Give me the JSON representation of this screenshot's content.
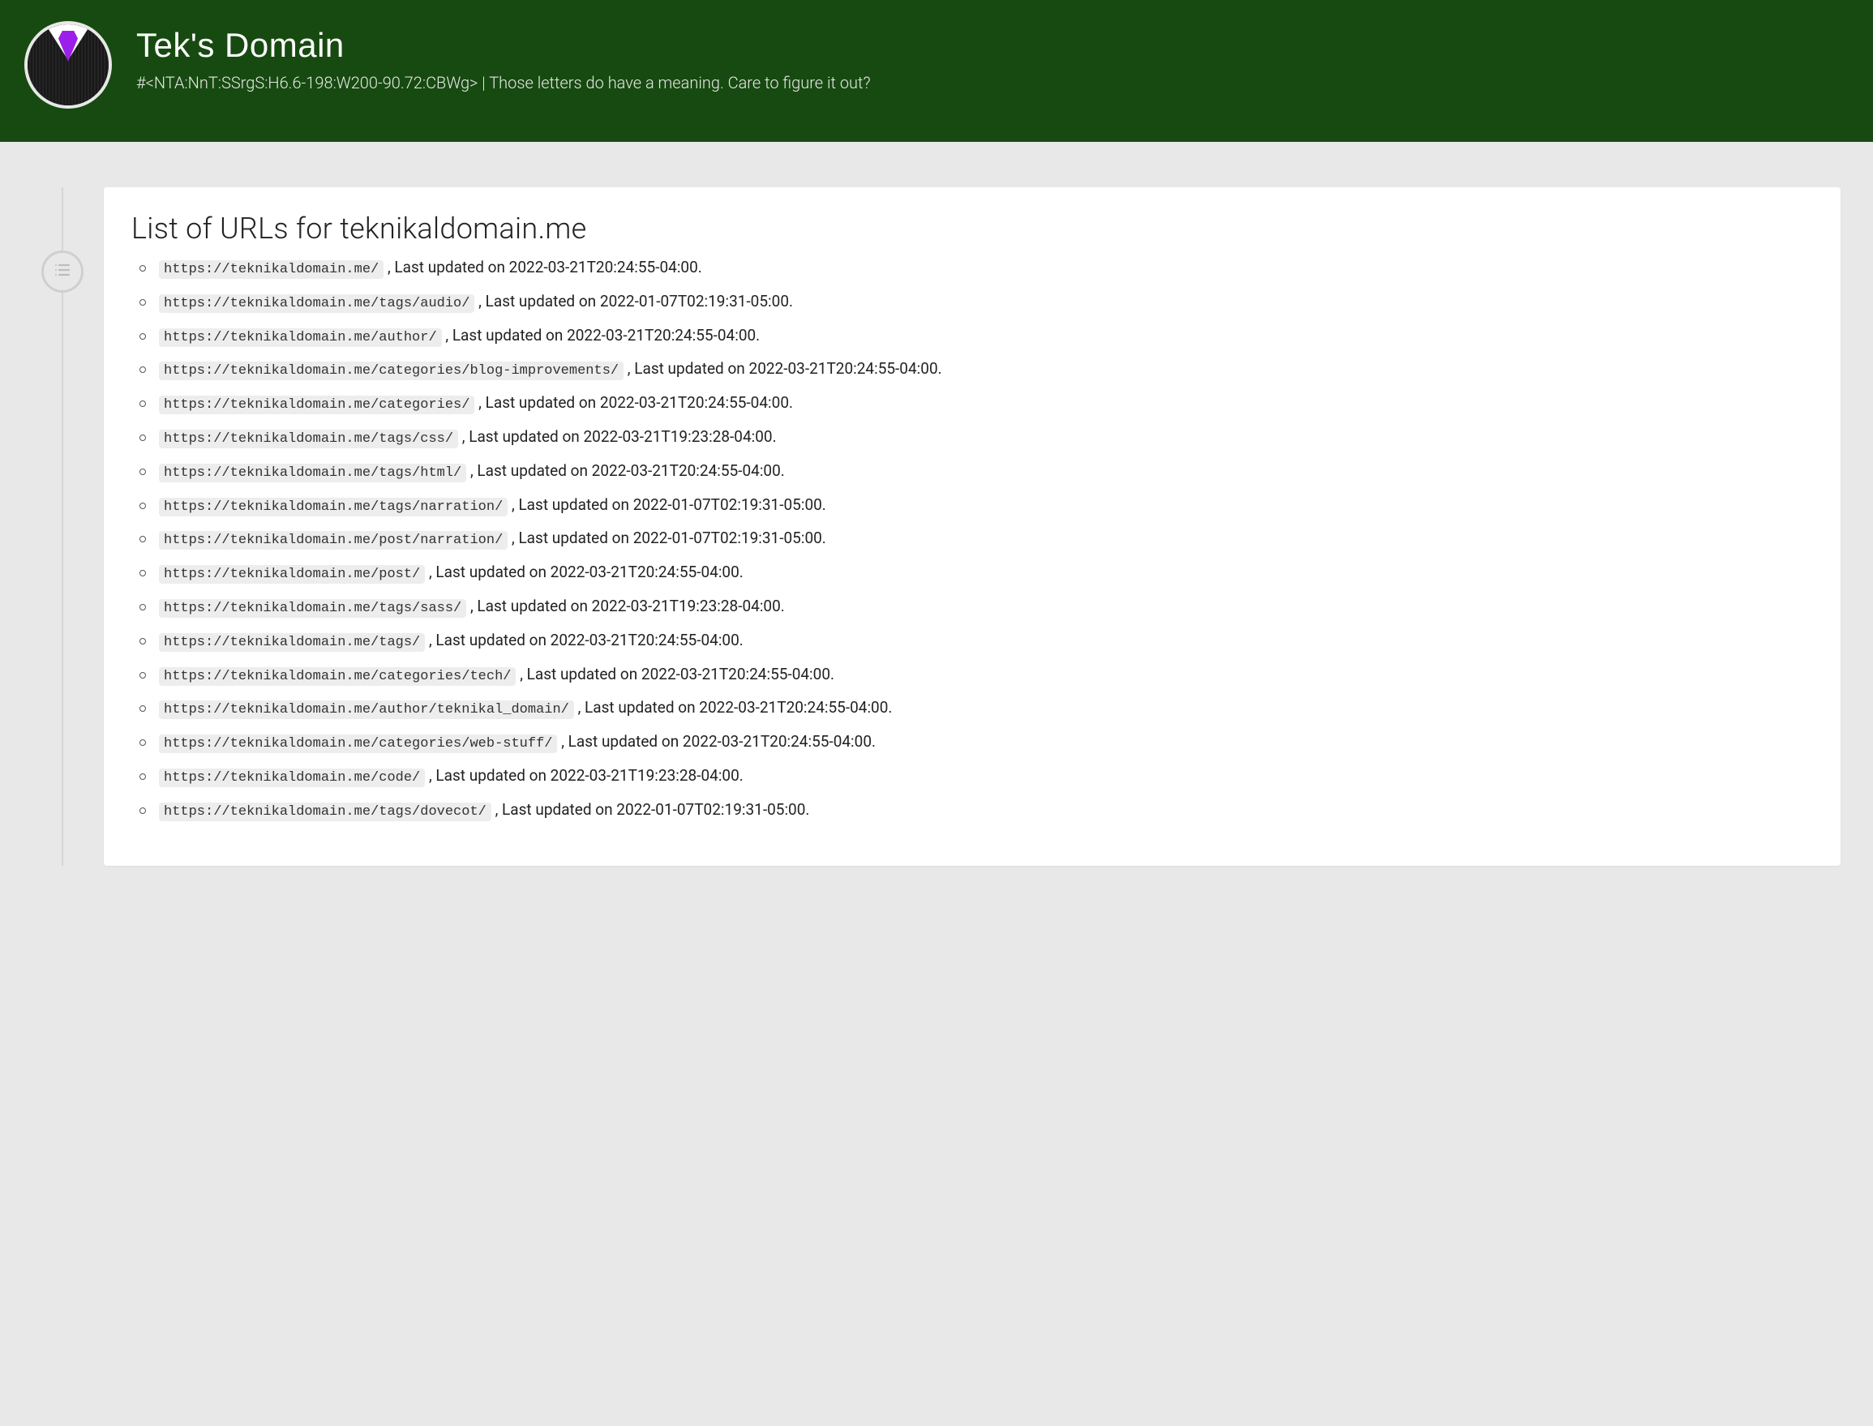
{
  "header": {
    "title": "Tek's Domain",
    "tagline": "#<NTA:NnT:SSrgS:H6.6-198:W200-90.72:CBWg> | Those letters do have a meaning. Care to figure it out?"
  },
  "page": {
    "title": "List of URLs for teknikaldomain.me",
    "last_updated_prefix": " , Last updated on ",
    "suffix": "."
  },
  "urls": [
    {
      "url": "https://teknikaldomain.me/",
      "ts": "2022-03-21T20:24:55-04:00"
    },
    {
      "url": "https://teknikaldomain.me/tags/audio/",
      "ts": "2022-01-07T02:19:31-05:00"
    },
    {
      "url": "https://teknikaldomain.me/author/",
      "ts": "2022-03-21T20:24:55-04:00"
    },
    {
      "url": "https://teknikaldomain.me/categories/blog-improvements/",
      "ts": "2022-03-21T20:24:55-04:00"
    },
    {
      "url": "https://teknikaldomain.me/categories/",
      "ts": "2022-03-21T20:24:55-04:00"
    },
    {
      "url": "https://teknikaldomain.me/tags/css/",
      "ts": "2022-03-21T19:23:28-04:00"
    },
    {
      "url": "https://teknikaldomain.me/tags/html/",
      "ts": "2022-03-21T20:24:55-04:00"
    },
    {
      "url": "https://teknikaldomain.me/tags/narration/",
      "ts": "2022-01-07T02:19:31-05:00"
    },
    {
      "url": "https://teknikaldomain.me/post/narration/",
      "ts": "2022-01-07T02:19:31-05:00"
    },
    {
      "url": "https://teknikaldomain.me/post/",
      "ts": "2022-03-21T20:24:55-04:00"
    },
    {
      "url": "https://teknikaldomain.me/tags/sass/",
      "ts": "2022-03-21T19:23:28-04:00"
    },
    {
      "url": "https://teknikaldomain.me/tags/",
      "ts": "2022-03-21T20:24:55-04:00"
    },
    {
      "url": "https://teknikaldomain.me/categories/tech/",
      "ts": "2022-03-21T20:24:55-04:00"
    },
    {
      "url": "https://teknikaldomain.me/author/teknikal_domain/",
      "ts": "2022-03-21T20:24:55-04:00"
    },
    {
      "url": "https://teknikaldomain.me/categories/web-stuff/",
      "ts": "2022-03-21T20:24:55-04:00"
    },
    {
      "url": "https://teknikaldomain.me/code/",
      "ts": "2022-03-21T19:23:28-04:00"
    },
    {
      "url": "https://teknikaldomain.me/tags/dovecot/",
      "ts": "2022-01-07T02:19:31-05:00"
    }
  ]
}
